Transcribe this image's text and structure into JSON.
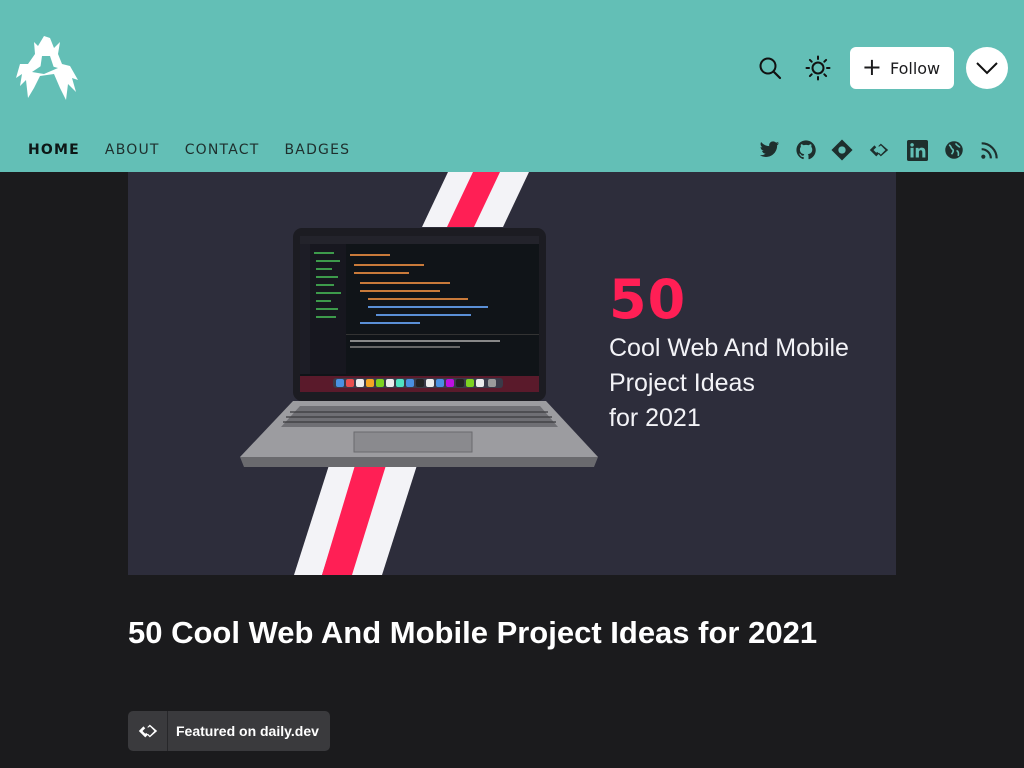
{
  "header": {
    "logo_name": "blog-logo",
    "follow_label": "Follow",
    "nav": [
      "HOME",
      "ABOUT",
      "CONTACT",
      "BADGES"
    ],
    "social": [
      "twitter-icon",
      "github-icon",
      "hashnode-icon",
      "dailydev-icon",
      "linkedin-icon",
      "website-icon",
      "rss-icon"
    ]
  },
  "cover": {
    "number": "50",
    "line1": "Cool Web And Mobile",
    "line2": "Project Ideas",
    "line3": "for 2021"
  },
  "article": {
    "title": "50 Cool Web And Mobile Project Ideas for 2021",
    "badge": "Featured on daily.dev"
  },
  "colors": {
    "header_bg": "#63bfb6",
    "page_bg": "#1b1b1d",
    "cover_bg": "#2d2d3b",
    "accent": "#ff1f55"
  }
}
